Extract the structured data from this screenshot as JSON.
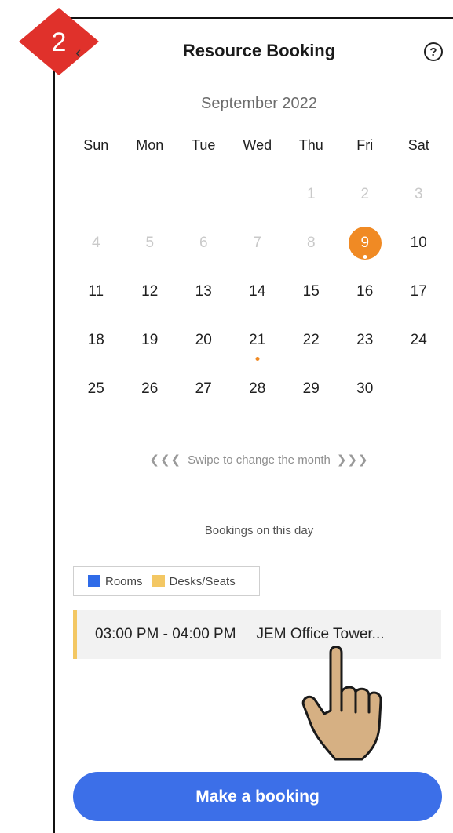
{
  "step_badge": "2",
  "header": {
    "title": "Resource Booking",
    "back_icon": "back-arrow-icon",
    "help_icon": "?"
  },
  "calendar": {
    "month_label": "September 2022",
    "weekdays": [
      "Sun",
      "Mon",
      "Tue",
      "Wed",
      "Thu",
      "Fri",
      "Sat"
    ],
    "selected_day": "9",
    "weeks": [
      [
        {
          "d": "",
          "m": false
        },
        {
          "d": "",
          "m": false
        },
        {
          "d": "",
          "m": false
        },
        {
          "d": "",
          "m": false
        },
        {
          "d": "1",
          "m": true
        },
        {
          "d": "2",
          "m": true
        },
        {
          "d": "3",
          "m": true
        }
      ],
      [
        {
          "d": "4",
          "m": true
        },
        {
          "d": "5",
          "m": true
        },
        {
          "d": "6",
          "m": true
        },
        {
          "d": "7",
          "m": true
        },
        {
          "d": "8",
          "m": true
        },
        {
          "d": "9",
          "m": false,
          "sel": true,
          "dot": true
        },
        {
          "d": "10",
          "m": false
        }
      ],
      [
        {
          "d": "11"
        },
        {
          "d": "12"
        },
        {
          "d": "13"
        },
        {
          "d": "14"
        },
        {
          "d": "15"
        },
        {
          "d": "16"
        },
        {
          "d": "17"
        }
      ],
      [
        {
          "d": "18"
        },
        {
          "d": "19"
        },
        {
          "d": "20"
        },
        {
          "d": "21",
          "dot": true
        },
        {
          "d": "22"
        },
        {
          "d": "23"
        },
        {
          "d": "24"
        }
      ],
      [
        {
          "d": "25"
        },
        {
          "d": "26"
        },
        {
          "d": "27"
        },
        {
          "d": "28"
        },
        {
          "d": "29"
        },
        {
          "d": "30"
        },
        {
          "d": ""
        }
      ]
    ],
    "swipe_left": "❮❮❮",
    "swipe_hint": "Swipe to change the month",
    "swipe_right": "❯❯❯"
  },
  "bookings": {
    "section_label": "Bookings on this day",
    "legend": [
      {
        "label": "Rooms",
        "color": "#2f6be8"
      },
      {
        "label": "Desks/Seats",
        "color": "#f3c763"
      }
    ],
    "items": [
      {
        "time": "03:00 PM - 04:00 PM",
        "location": "JEM Office Tower...",
        "color": "#f3c763"
      }
    ]
  },
  "cta": {
    "label": "Make a booking"
  },
  "colors": {
    "accent": "#f08a24",
    "primary": "#3c6fe8",
    "badge": "#e0312b"
  }
}
